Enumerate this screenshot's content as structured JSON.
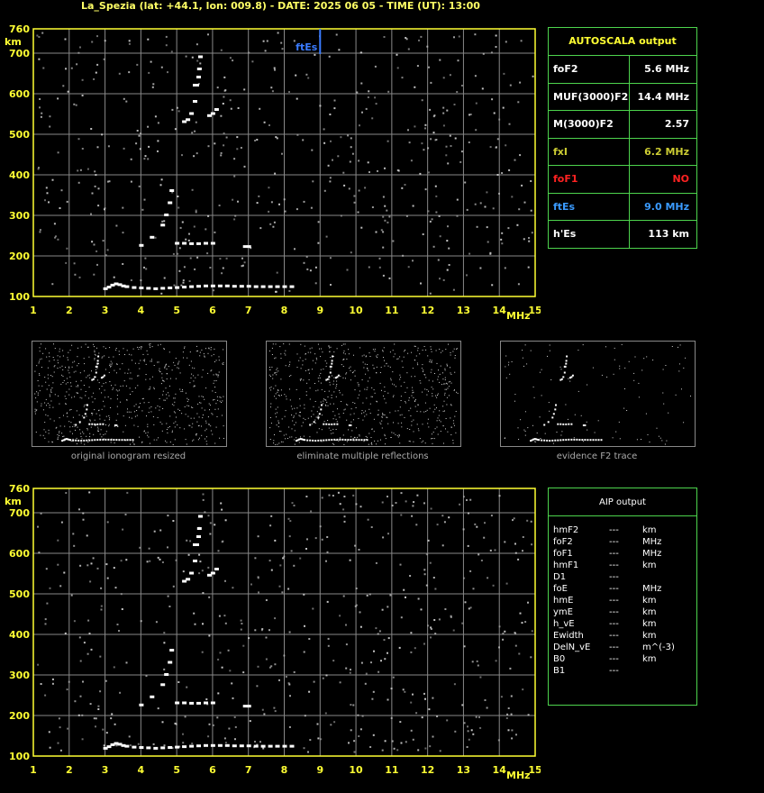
{
  "title": "La_Spezia (lat: +44.1, lon: 009.8) - DATE: 2025 06 05 - TIME (UT): 13:00",
  "colors": {
    "axis": "#ffff33",
    "grid": "#888888",
    "trace": "#ffffff",
    "noise": "#c8c8c8",
    "ftes_marker": "#3a7bff",
    "table_border": "#4dd44d"
  },
  "chart_data": [
    {
      "type": "scatter",
      "name": "ionogram-top",
      "xlabel": "MHz",
      "ylabel": "km",
      "xlim": [
        1,
        15
      ],
      "ylim": [
        100,
        760
      ],
      "x_ticks": [
        "1",
        "2",
        "3",
        "4",
        "5",
        "6",
        "7",
        "8",
        "9",
        "10",
        "11",
        "12",
        "13",
        "14",
        "15"
      ],
      "y_ticks": [
        "100",
        "200",
        "300",
        "400",
        "500",
        "600",
        "700",
        "760"
      ],
      "marker_label": "ftEs",
      "marker_freq": 9.0,
      "traces": {
        "es_trace": {
          "x": [
            3.0,
            3.1,
            3.2,
            3.3,
            3.4,
            3.5,
            3.6,
            3.8,
            4.0,
            4.2,
            4.4,
            4.6,
            4.8,
            5.0,
            5.2,
            5.4,
            5.6,
            5.8,
            6.0,
            6.2,
            6.4,
            6.6,
            6.8,
            7.0,
            7.2,
            7.4,
            7.6,
            7.8,
            8.0,
            8.2
          ],
          "y": [
            118,
            122,
            127,
            130,
            128,
            125,
            123,
            121,
            120,
            119,
            118,
            119,
            120,
            121,
            122,
            123,
            124,
            125,
            125,
            125,
            125,
            124,
            124,
            124,
            123,
            123,
            123,
            123,
            123,
            123
          ]
        },
        "e_trace": {
          "x": [
            5.0,
            5.2,
            5.4,
            5.6,
            5.8,
            6.0,
            6.9,
            7.0
          ],
          "y": [
            230,
            230,
            229,
            229,
            230,
            230,
            222,
            222
          ]
        },
        "f1_trace": {
          "x": [
            4.0,
            4.3,
            4.6,
            4.7,
            4.8,
            4.85
          ],
          "y": [
            225,
            245,
            275,
            300,
            330,
            360
          ]
        },
        "f2_lower": {
          "x": [
            5.2,
            5.3,
            5.4,
            5.5,
            5.55
          ],
          "y": [
            530,
            535,
            550,
            580,
            620
          ]
        },
        "f2_upper": {
          "x": [
            5.5,
            5.6,
            5.62,
            5.65
          ],
          "y": [
            620,
            640,
            660,
            690
          ]
        },
        "f2_x": {
          "x": [
            5.9,
            6.0,
            6.1
          ],
          "y": [
            545,
            550,
            560
          ]
        }
      }
    },
    {
      "type": "scatter",
      "name": "ionogram-bottom",
      "xlabel": "MHz",
      "ylabel": "km",
      "xlim": [
        1,
        15
      ],
      "ylim": [
        100,
        760
      ],
      "x_ticks": [
        "1",
        "2",
        "3",
        "4",
        "5",
        "6",
        "7",
        "8",
        "9",
        "10",
        "11",
        "12",
        "13",
        "14",
        "15"
      ],
      "y_ticks": [
        "100",
        "200",
        "300",
        "400",
        "500",
        "600",
        "700",
        "760"
      ]
    }
  ],
  "autoscala": {
    "title": "AUTOSCALA output",
    "rows": [
      {
        "label": "foF2",
        "value": "5.6 MHz",
        "color": "#ffffff"
      },
      {
        "label": "MUF(3000)F2",
        "value": "14.4 MHz",
        "color": "#ffffff"
      },
      {
        "label": "M(3000)F2",
        "value": "2.57",
        "color": "#ffffff"
      },
      {
        "label": "fxI",
        "value": "6.2 MHz",
        "color": "#cccc33"
      },
      {
        "label": "foF1",
        "value": "NO",
        "color": "#ff2222"
      },
      {
        "label": "ftEs",
        "value": "9.0 MHz",
        "color": "#3a9bff"
      },
      {
        "label": "h'Es",
        "value": "113 km",
        "color": "#ffffff"
      }
    ]
  },
  "thumbnails": [
    {
      "caption": "original ionogram resized"
    },
    {
      "caption": "eliminate multiple reflections"
    },
    {
      "caption": "evidence F2 trace"
    }
  ],
  "aip": {
    "title": "AIP output",
    "rows": [
      {
        "label": "hmF2",
        "value": "---",
        "unit": "km"
      },
      {
        "label": "foF2",
        "value": "---",
        "unit": "MHz"
      },
      {
        "label": "foF1",
        "value": "---",
        "unit": "MHz"
      },
      {
        "label": "hmF1",
        "value": "---",
        "unit": "km"
      },
      {
        "label": "D1",
        "value": "---",
        "unit": ""
      },
      {
        "label": "foE",
        "value": "---",
        "unit": "MHz"
      },
      {
        "label": "hmE",
        "value": "---",
        "unit": "km"
      },
      {
        "label": "ymE",
        "value": "---",
        "unit": "km"
      },
      {
        "label": "h_vE",
        "value": "---",
        "unit": "km"
      },
      {
        "label": "Ewidth",
        "value": "---",
        "unit": "km"
      },
      {
        "label": "DelN_vE",
        "value": "---",
        "unit": "m^(-3)"
      },
      {
        "label": "B0",
        "value": "---",
        "unit": "km"
      },
      {
        "label": "B1",
        "value": "---",
        "unit": ""
      }
    ]
  }
}
